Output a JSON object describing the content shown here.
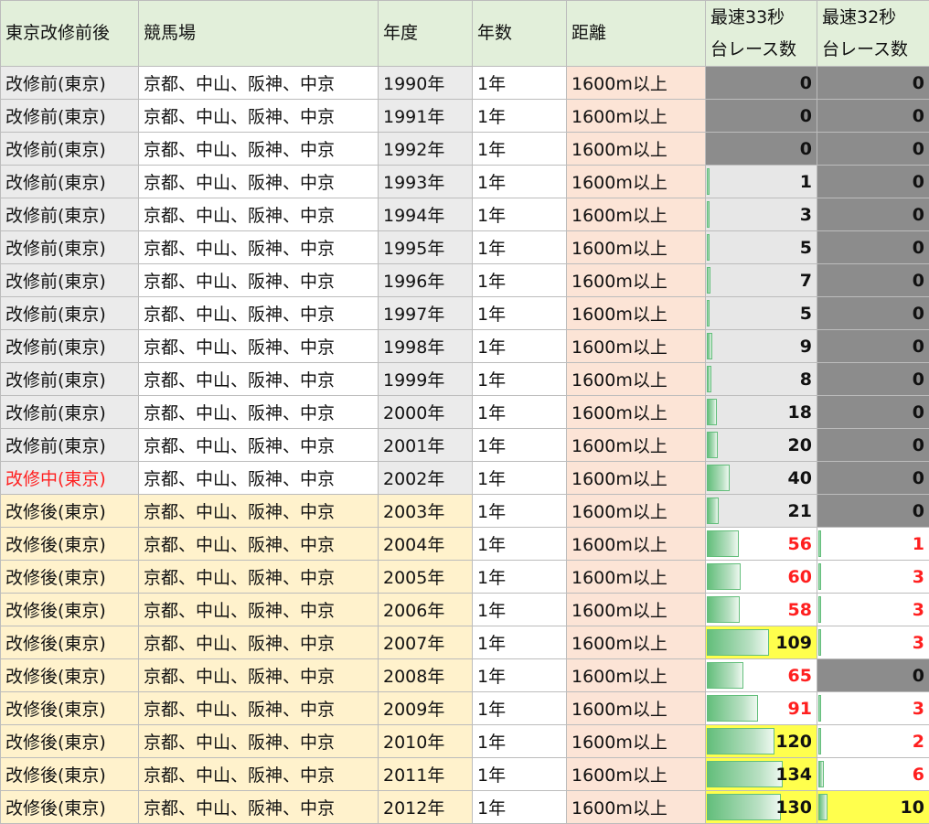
{
  "headers": {
    "era": "東京改修前後",
    "venue": "競馬場",
    "year": "年度",
    "span": "年数",
    "dist": "距離",
    "r33_l1": "最速33秒",
    "r33_l2": "台レース数",
    "r32_l1": "最速32秒",
    "r32_l2": "台レース数"
  },
  "colors": {
    "header_bg": "#e2efda",
    "pre_bg": "#ebebeb",
    "post_bg": "#fff2cc",
    "dist_bg": "#fce4d6",
    "zero_cell_bg": "#8c8c8c",
    "highlight_bg": "#ffff4d",
    "databar": "#63be7b",
    "red_text": "#ff1f1f"
  },
  "bar_max": 134,
  "rows": [
    {
      "era": "改修前(東京)",
      "phase": "pre",
      "venue": "京都、中山、阪神、中京",
      "year": "1990年",
      "span": "1年",
      "dist": "1600m以上",
      "r33": 0,
      "r32": 0
    },
    {
      "era": "改修前(東京)",
      "phase": "pre",
      "venue": "京都、中山、阪神、中京",
      "year": "1991年",
      "span": "1年",
      "dist": "1600m以上",
      "r33": 0,
      "r32": 0
    },
    {
      "era": "改修前(東京)",
      "phase": "pre",
      "venue": "京都、中山、阪神、中京",
      "year": "1992年",
      "span": "1年",
      "dist": "1600m以上",
      "r33": 0,
      "r32": 0
    },
    {
      "era": "改修前(東京)",
      "phase": "pre",
      "venue": "京都、中山、阪神、中京",
      "year": "1993年",
      "span": "1年",
      "dist": "1600m以上",
      "r33": 1,
      "r32": 0
    },
    {
      "era": "改修前(東京)",
      "phase": "pre",
      "venue": "京都、中山、阪神、中京",
      "year": "1994年",
      "span": "1年",
      "dist": "1600m以上",
      "r33": 3,
      "r32": 0
    },
    {
      "era": "改修前(東京)",
      "phase": "pre",
      "venue": "京都、中山、阪神、中京",
      "year": "1995年",
      "span": "1年",
      "dist": "1600m以上",
      "r33": 5,
      "r32": 0
    },
    {
      "era": "改修前(東京)",
      "phase": "pre",
      "venue": "京都、中山、阪神、中京",
      "year": "1996年",
      "span": "1年",
      "dist": "1600m以上",
      "r33": 7,
      "r32": 0
    },
    {
      "era": "改修前(東京)",
      "phase": "pre",
      "venue": "京都、中山、阪神、中京",
      "year": "1997年",
      "span": "1年",
      "dist": "1600m以上",
      "r33": 5,
      "r32": 0
    },
    {
      "era": "改修前(東京)",
      "phase": "pre",
      "venue": "京都、中山、阪神、中京",
      "year": "1998年",
      "span": "1年",
      "dist": "1600m以上",
      "r33": 9,
      "r32": 0
    },
    {
      "era": "改修前(東京)",
      "phase": "pre",
      "venue": "京都、中山、阪神、中京",
      "year": "1999年",
      "span": "1年",
      "dist": "1600m以上",
      "r33": 8,
      "r32": 0
    },
    {
      "era": "改修前(東京)",
      "phase": "pre",
      "venue": "京都、中山、阪神、中京",
      "year": "2000年",
      "span": "1年",
      "dist": "1600m以上",
      "r33": 18,
      "r32": 0
    },
    {
      "era": "改修前(東京)",
      "phase": "pre",
      "venue": "京都、中山、阪神、中京",
      "year": "2001年",
      "span": "1年",
      "dist": "1600m以上",
      "r33": 20,
      "r32": 0
    },
    {
      "era": "改修中(東京)",
      "phase": "mid",
      "venue": "京都、中山、阪神、中京",
      "year": "2002年",
      "span": "1年",
      "dist": "1600m以上",
      "r33": 40,
      "r32": 0
    },
    {
      "era": "改修後(東京)",
      "phase": "post",
      "venue": "京都、中山、阪神、中京",
      "year": "2003年",
      "span": "1年",
      "dist": "1600m以上",
      "r33": 21,
      "r32": 0
    },
    {
      "era": "改修後(東京)",
      "phase": "post",
      "venue": "京都、中山、阪神、中京",
      "year": "2004年",
      "span": "1年",
      "dist": "1600m以上",
      "r33": 56,
      "r32": 1
    },
    {
      "era": "改修後(東京)",
      "phase": "post",
      "venue": "京都、中山、阪神、中京",
      "year": "2005年",
      "span": "1年",
      "dist": "1600m以上",
      "r33": 60,
      "r32": 3
    },
    {
      "era": "改修後(東京)",
      "phase": "post",
      "venue": "京都、中山、阪神、中京",
      "year": "2006年",
      "span": "1年",
      "dist": "1600m以上",
      "r33": 58,
      "r32": 3
    },
    {
      "era": "改修後(東京)",
      "phase": "post",
      "venue": "京都、中山、阪神、中京",
      "year": "2007年",
      "span": "1年",
      "dist": "1600m以上",
      "r33": 109,
      "r32": 3
    },
    {
      "era": "改修後(東京)",
      "phase": "post",
      "venue": "京都、中山、阪神、中京",
      "year": "2008年",
      "span": "1年",
      "dist": "1600m以上",
      "r33": 65,
      "r32": 0
    },
    {
      "era": "改修後(東京)",
      "phase": "post",
      "venue": "京都、中山、阪神、中京",
      "year": "2009年",
      "span": "1年",
      "dist": "1600m以上",
      "r33": 91,
      "r32": 3
    },
    {
      "era": "改修後(東京)",
      "phase": "post",
      "venue": "京都、中山、阪神、中京",
      "year": "2010年",
      "span": "1年",
      "dist": "1600m以上",
      "r33": 120,
      "r32": 2
    },
    {
      "era": "改修後(東京)",
      "phase": "post",
      "venue": "京都、中山、阪神、中京",
      "year": "2011年",
      "span": "1年",
      "dist": "1600m以上",
      "r33": 134,
      "r32": 6
    },
    {
      "era": "改修後(東京)",
      "phase": "post",
      "venue": "京都、中山、阪神、中京",
      "year": "2012年",
      "span": "1年",
      "dist": "1600m以上",
      "r33": 130,
      "r32": 10
    }
  ]
}
